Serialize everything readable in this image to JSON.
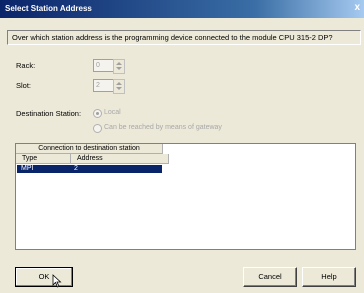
{
  "window": {
    "title": "Select Station Address",
    "close_glyph": "x"
  },
  "question": "Over which station address is the programming device connected to the module CPU 315-2 DP?",
  "rack": {
    "label": "Rack:",
    "value": "0"
  },
  "slot": {
    "label": "Slot:",
    "value": "2"
  },
  "destination": {
    "label": "Destination Station:",
    "option_local": "Local",
    "option_gateway": "Can be reached by means of gateway"
  },
  "connection_table": {
    "group_header": "Connection to destination station",
    "columns": [
      "Type",
      "Address"
    ],
    "rows": [
      {
        "type": "MPI",
        "address": "2"
      }
    ]
  },
  "buttons": {
    "ok": "OK",
    "cancel": "Cancel",
    "help": "Help"
  },
  "colors": {
    "title_bar": "#0a246a",
    "selection": "#0a246a",
    "dialog_bg": "#ece9d8"
  }
}
